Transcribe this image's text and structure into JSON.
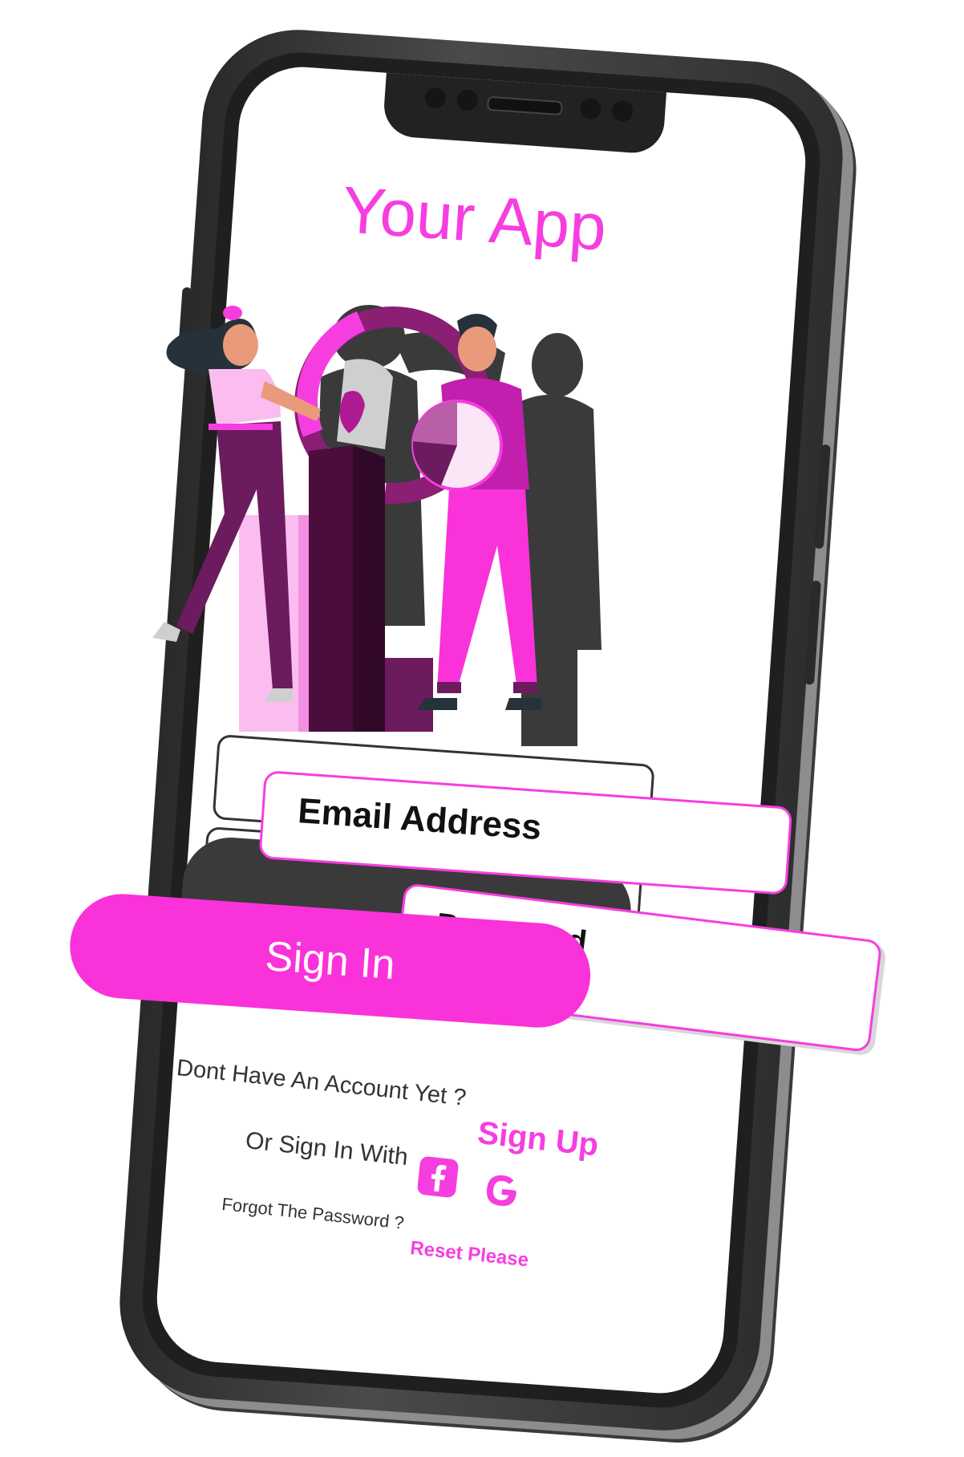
{
  "app": {
    "title": "Your App"
  },
  "form": {
    "email_label": "Email Address",
    "password_label": "Password",
    "signin_label": "Sign In"
  },
  "links": {
    "no_account": "Dont Have An Account Yet ?",
    "signup": "Sign Up",
    "or_signin": "Or Sign In With",
    "forgot": "Forgot The Password ?",
    "reset": "Reset Please"
  },
  "social": [
    "facebook-icon",
    "google-icon"
  ],
  "colors": {
    "accent": "#f63ee0",
    "button": "#fa32da",
    "dark_purple": "#4a0d3c",
    "mid_purple": "#6b1b5e",
    "light_pink": "#fbbcf0",
    "phone": "#2e2e2e"
  }
}
